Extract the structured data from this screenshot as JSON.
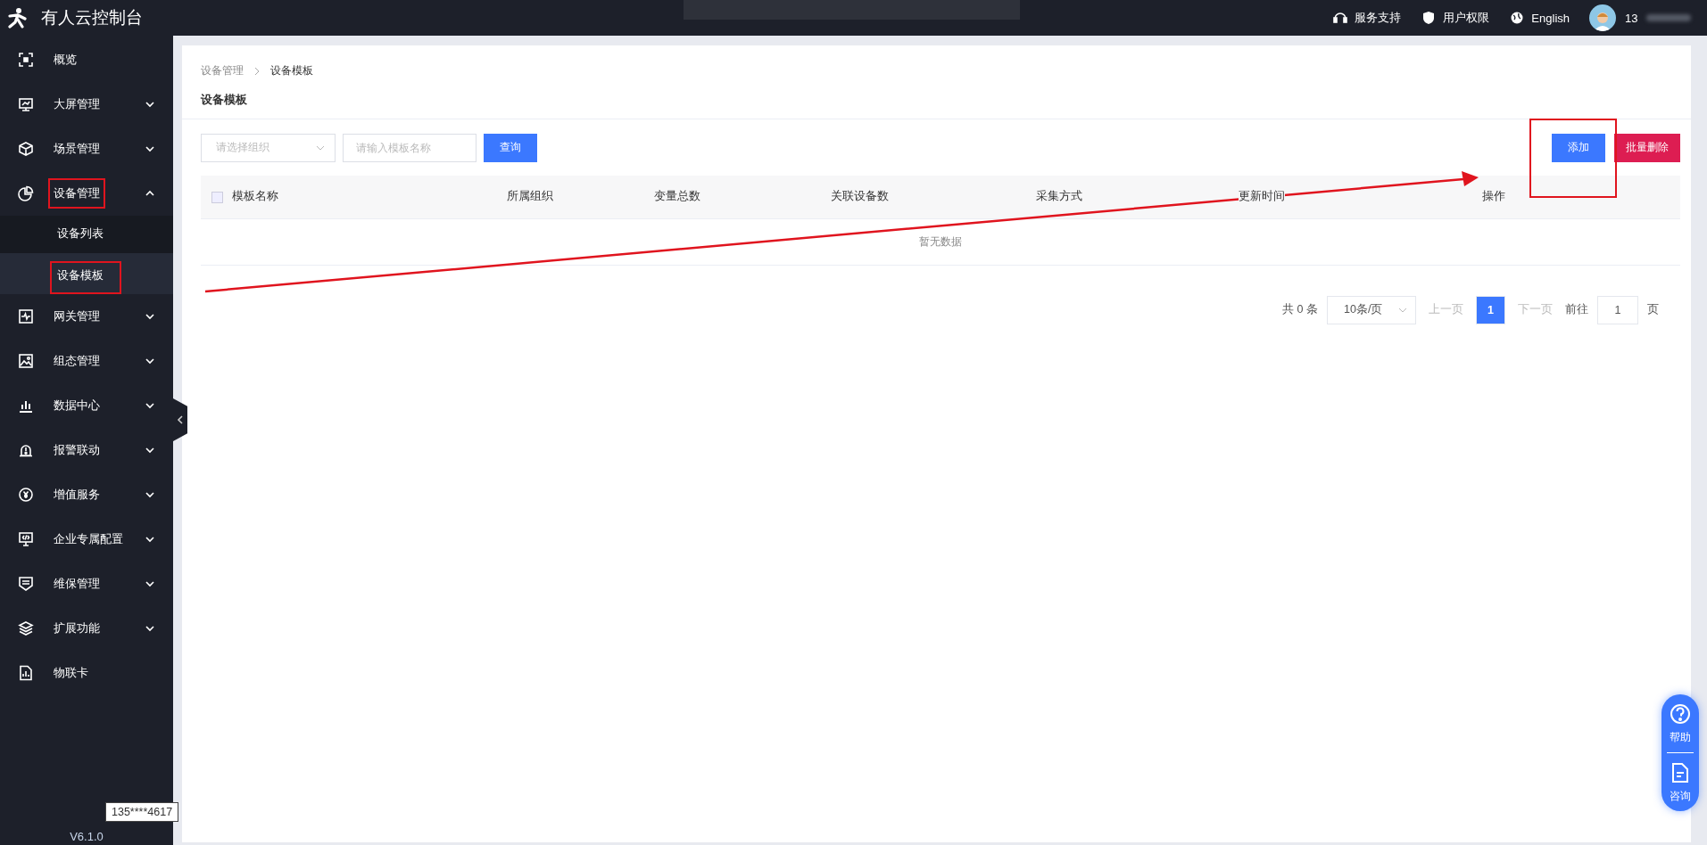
{
  "header": {
    "title": "有人云控制台",
    "links": [
      {
        "label": "服务支持"
      },
      {
        "label": "用户权限"
      },
      {
        "label": "English"
      }
    ],
    "user": "13"
  },
  "sidebar": {
    "items": [
      {
        "label": "概览"
      },
      {
        "label": "大屏管理",
        "expanded": false
      },
      {
        "label": "场景管理",
        "expanded": false
      },
      {
        "label": "设备管理",
        "expanded": true,
        "annotated": true,
        "children": [
          {
            "label": "设备列表",
            "selected": false,
            "annotated": false
          },
          {
            "label": "设备模板",
            "selected": true,
            "annotated": true
          }
        ]
      },
      {
        "label": "网关管理",
        "expanded": false
      },
      {
        "label": "组态管理",
        "expanded": false
      },
      {
        "label": "数据中心",
        "expanded": false
      },
      {
        "label": "报警联动",
        "expanded": false
      },
      {
        "label": "增值服务",
        "expanded": false
      },
      {
        "label": "企业专属配置",
        "expanded": false
      },
      {
        "label": "维保管理",
        "expanded": false
      },
      {
        "label": "扩展功能",
        "expanded": false
      },
      {
        "label": "物联卡"
      }
    ],
    "version": "V6.1.0",
    "tooltip": "135****4617"
  },
  "breadcrumb": [
    "设备管理",
    "设备模板"
  ],
  "page_title": "设备模板",
  "filters": {
    "organization": {
      "placeholder": "请选择组织"
    },
    "name": {
      "placeholder": "请输入模板名称"
    },
    "search_button": "查询"
  },
  "actions": [
    {
      "label": "添加",
      "kind": "primary",
      "annotated": true
    },
    {
      "label": "批量删除",
      "kind": "danger",
      "annotated": false
    }
  ],
  "annotation_arrow": true,
  "table": {
    "columns": [
      "模板名称",
      "所属组织",
      "变量总数",
      "关联设备数",
      "采集方式",
      "更新时间",
      "操作"
    ],
    "select_all": false,
    "empty_text": "暂无数据"
  },
  "pagination": {
    "total": "共 0 条",
    "page_size": "10条/页",
    "prev": "上一页",
    "pages": [
      {
        "label": "1",
        "selected": true
      }
    ],
    "next": "下一页",
    "goto_label": "前往",
    "goto_value": "1",
    "goto_suffix": "页"
  },
  "float_help": [
    {
      "label": "帮助"
    },
    {
      "label": "咨询"
    }
  ]
}
